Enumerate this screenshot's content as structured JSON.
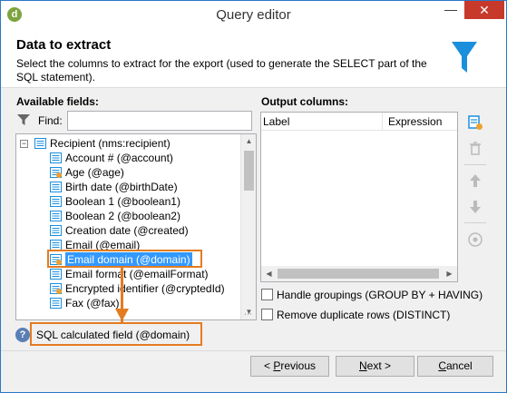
{
  "window": {
    "title": "Query editor",
    "app_icon_letter": "d",
    "minimize_glyph": "—",
    "close_glyph": "✕"
  },
  "header": {
    "title": "Data to extract",
    "description": "Select the columns to extract for the export (used to generate the SELECT part of the SQL statement)."
  },
  "available_fields": {
    "label": "Available fields:",
    "find_label": "Find:",
    "find_value": "",
    "tree": [
      {
        "label": "Recipient (nms:recipient)",
        "icon": "table-icon",
        "level": 0,
        "expanded": true
      },
      {
        "label": "Account # (@account)",
        "icon": "field-icon",
        "level": 1
      },
      {
        "label": "Age (@age)",
        "icon": "calc-field-icon",
        "level": 1
      },
      {
        "label": "Birth date (@birthDate)",
        "icon": "field-icon",
        "level": 1
      },
      {
        "label": "Boolean 1 (@boolean1)",
        "icon": "field-icon",
        "level": 1
      },
      {
        "label": "Boolean 2 (@boolean2)",
        "icon": "field-icon",
        "level": 1
      },
      {
        "label": "Creation date (@created)",
        "icon": "field-icon",
        "level": 1
      },
      {
        "label": "Email (@email)",
        "icon": "field-icon",
        "level": 1
      },
      {
        "label": "Email domain (@domain)",
        "icon": "calc-field-icon",
        "level": 1,
        "selected": true
      },
      {
        "label": "Email format (@emailFormat)",
        "icon": "field-icon",
        "level": 1
      },
      {
        "label": "Encrypted identifier (@cryptedId)",
        "icon": "calc-field-icon",
        "level": 1
      },
      {
        "label": "Fax (@fax)",
        "icon": "field-icon",
        "level": 1
      }
    ]
  },
  "output_columns": {
    "label": "Output columns:",
    "headers": [
      "Label",
      "Expression"
    ]
  },
  "options": {
    "handle_groupings": {
      "label": "Handle groupings (GROUP BY + HAVING)",
      "checked": false
    },
    "remove_duplicates": {
      "label": "Remove duplicate rows (DISTINCT)",
      "checked": false
    }
  },
  "status": {
    "text": "SQL calculated field (@domain)"
  },
  "buttons": {
    "previous": {
      "prefix": "< ",
      "mnemonic": "P",
      "rest": "revious"
    },
    "next": {
      "mnemonic": "N",
      "rest": "ext >"
    },
    "cancel": {
      "mnemonic": "C",
      "rest": "ancel"
    }
  },
  "colors": {
    "accent": "#2b78c6",
    "highlight": "#e37c21",
    "selection": "#3399ff",
    "close": "#c7392b"
  }
}
